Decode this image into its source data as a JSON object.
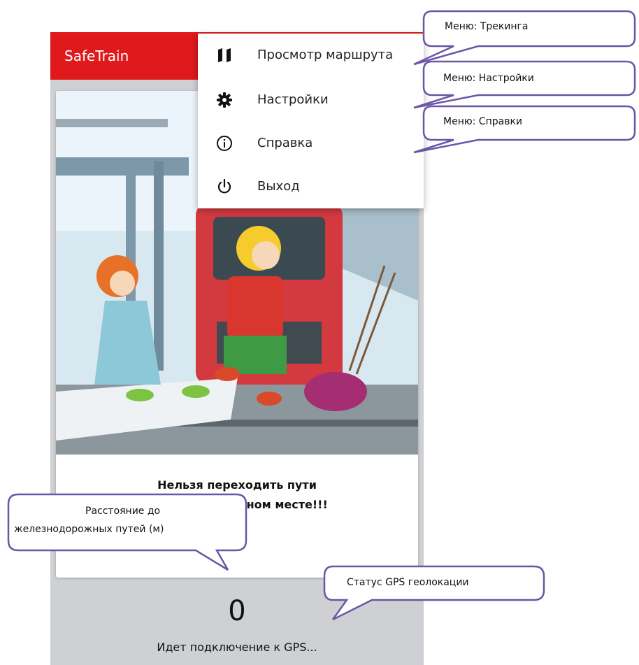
{
  "app": {
    "title": "SafeTrain"
  },
  "menu": {
    "items": [
      {
        "label": "Просмотр маршрута",
        "icon": "map-icon"
      },
      {
        "label": "Настройки",
        "icon": "gear-icon"
      },
      {
        "label": "Справка",
        "icon": "info-icon"
      },
      {
        "label": "Выход",
        "icon": "power-icon"
      }
    ]
  },
  "card": {
    "warning_line1": "Нельзя переходить пути",
    "warning_line2": "в неустановленном месте!!!"
  },
  "status": {
    "distance": "0",
    "gps": "Идет подключение к GPS..."
  },
  "callouts": {
    "tracking_menu": "Меню: Трекинга",
    "settings_menu": "Меню: Настройки",
    "help_menu": "Меню: Справки",
    "distance_line1": "Расстояние до",
    "distance_line2": "железнодорожных путей (м)",
    "gps_status": "Статус GPS геолокации"
  },
  "colors": {
    "accent": "#e0191c",
    "callout_border": "#6a56a6"
  }
}
